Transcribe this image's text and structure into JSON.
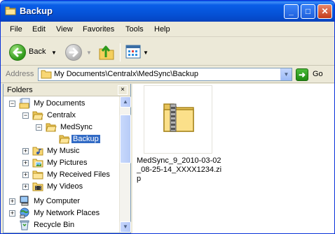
{
  "window": {
    "title": "Backup",
    "minimize_label": "_",
    "maximize_label": "□",
    "close_label": "✕"
  },
  "menu": {
    "items": [
      {
        "label": "File"
      },
      {
        "label": "Edit"
      },
      {
        "label": "View"
      },
      {
        "label": "Favorites"
      },
      {
        "label": "Tools"
      },
      {
        "label": "Help"
      }
    ]
  },
  "toolbar": {
    "back_label": "Back",
    "icons": [
      "back-arrow-icon",
      "forward-arrow-icon",
      "folder-up-icon",
      "views-icon"
    ]
  },
  "address": {
    "label": "Address",
    "path": "My Documents\\Centralx\\MedSync\\Backup",
    "go_label": "Go"
  },
  "folders": {
    "title": "Folders",
    "close_label": "×",
    "items": [
      {
        "label": "My Documents",
        "expander": "⊟",
        "icon": "my-documents-icon"
      },
      {
        "label": "Centralx",
        "expander": "⊟",
        "icon": "folder-open-icon"
      },
      {
        "label": "MedSync",
        "expander": "⊟",
        "icon": "folder-open-icon"
      },
      {
        "label": "Backup",
        "expander": "",
        "icon": "folder-open-icon",
        "selected": true
      },
      {
        "label": "My Music",
        "expander": "⊞",
        "icon": "music-folder-icon"
      },
      {
        "label": "My Pictures",
        "expander": "⊞",
        "icon": "pictures-folder-icon"
      },
      {
        "label": "My Received Files",
        "expander": "⊞",
        "icon": "folder-icon"
      },
      {
        "label": "My Videos",
        "expander": "⊞",
        "icon": "videos-folder-icon"
      },
      {
        "label": "My Computer",
        "expander": "⊞",
        "icon": "computer-icon"
      },
      {
        "label": "My Network Places",
        "expander": "⊞",
        "icon": "network-icon"
      },
      {
        "label": "Recycle Bin",
        "expander": "",
        "icon": "recycle-bin-icon"
      }
    ]
  },
  "files": [
    {
      "name": "MedSync_9_2010-03-02_08-25-14_XXXX1234.zip",
      "icon": "zip-folder-icon"
    }
  ],
  "colors": {
    "title_bar": "#0a5fe8",
    "selection": "#316ac5",
    "chrome": "#ece9d8"
  }
}
